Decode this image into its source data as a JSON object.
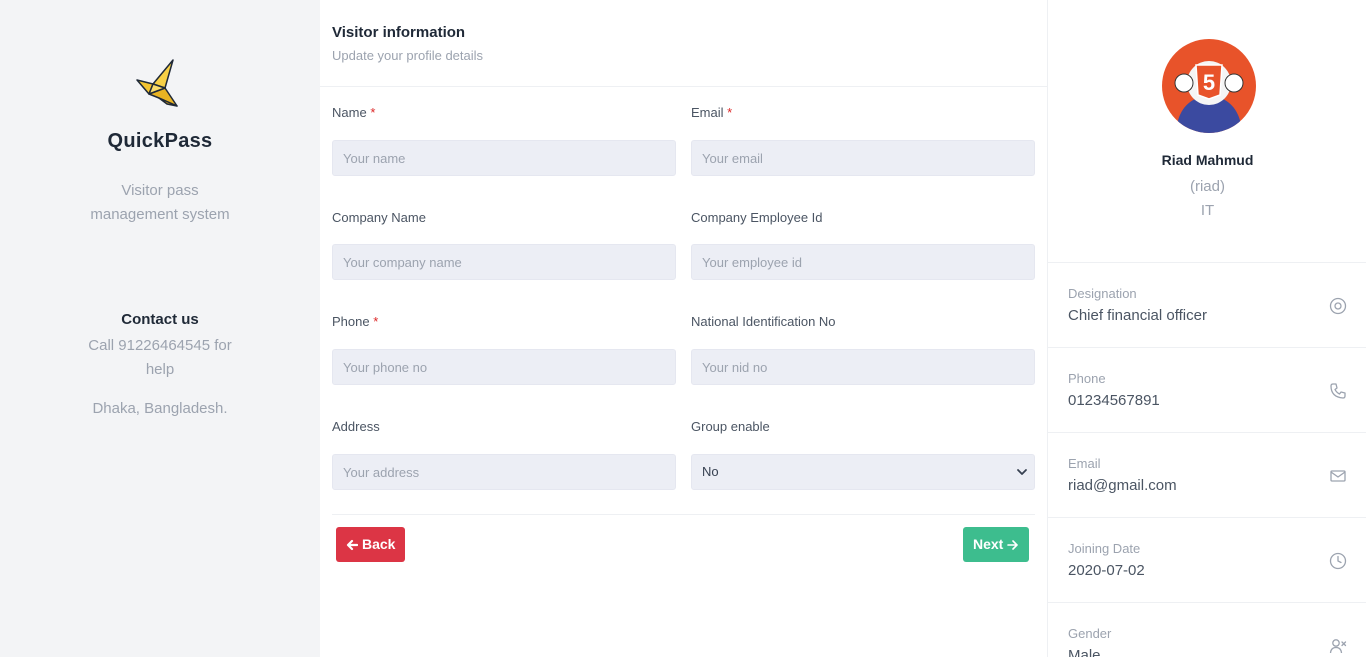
{
  "brand": {
    "name": "QuickPass",
    "tagline": "Visitor pass management system",
    "logo_icon": "origami-bird-icon"
  },
  "contact": {
    "title": "Contact us",
    "help": "Call 91226464545 for help",
    "address": "Dhaka, Bangladesh."
  },
  "form": {
    "title": "Visitor information",
    "subtitle": "Update your profile details",
    "fields": {
      "name": {
        "label": "Name",
        "required": "*",
        "placeholder": "Your name",
        "value": ""
      },
      "email": {
        "label": "Email",
        "required": "*",
        "placeholder": "Your email",
        "value": ""
      },
      "company_name": {
        "label": "Company Name",
        "placeholder": "Your company name",
        "value": ""
      },
      "employee_id": {
        "label": "Company Employee Id",
        "placeholder": "Your employee id",
        "value": ""
      },
      "phone": {
        "label": "Phone",
        "required": "*",
        "placeholder": "Your phone no",
        "value": ""
      },
      "nid": {
        "label": "National Identification No",
        "placeholder": "Your nid no",
        "value": ""
      },
      "address": {
        "label": "Address",
        "placeholder": "Your address",
        "value": ""
      },
      "group_enable": {
        "label": "Group enable",
        "selected": "No"
      }
    },
    "buttons": {
      "back": "Back",
      "next": "Next"
    }
  },
  "profile": {
    "name": "Riad Mahmud",
    "username": "(riad)",
    "department": "IT",
    "details": [
      {
        "label": "Designation",
        "value": "Chief financial officer",
        "icon": "target-icon"
      },
      {
        "label": "Phone",
        "value": "01234567891",
        "icon": "phone-icon"
      },
      {
        "label": "Email",
        "value": "riad@gmail.com",
        "icon": "mail-icon"
      },
      {
        "label": "Joining Date",
        "value": "2020-07-02",
        "icon": "clock-icon"
      },
      {
        "label": "Gender",
        "value": "Male",
        "icon": "user-icon"
      }
    ]
  },
  "colors": {
    "primary_danger": "#dc3545",
    "primary_success": "#3dbd8e",
    "sidebar_bg": "#f3f4f6",
    "input_bg": "#eceef5"
  }
}
